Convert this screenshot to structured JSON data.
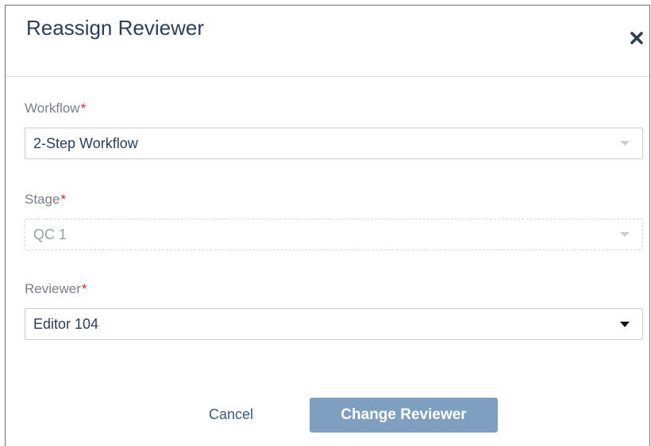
{
  "dialog": {
    "title": "Reassign Reviewer",
    "close_icon": "close-icon"
  },
  "form": {
    "workflow": {
      "label": "Workflow",
      "required_mark": "*",
      "value": "2-Step Workflow",
      "disabled": false
    },
    "stage": {
      "label": "Stage",
      "required_mark": "*",
      "value": "QC 1",
      "disabled": true
    },
    "reviewer": {
      "label": "Reviewer",
      "required_mark": "*",
      "value": "Editor 104",
      "disabled": false
    }
  },
  "actions": {
    "cancel_label": "Cancel",
    "primary_label": "Change Reviewer"
  },
  "colors": {
    "title": "#2f3e54",
    "required": "#d9262a",
    "primary_button": "#7f9fc1",
    "link": "#3d5a7a"
  }
}
